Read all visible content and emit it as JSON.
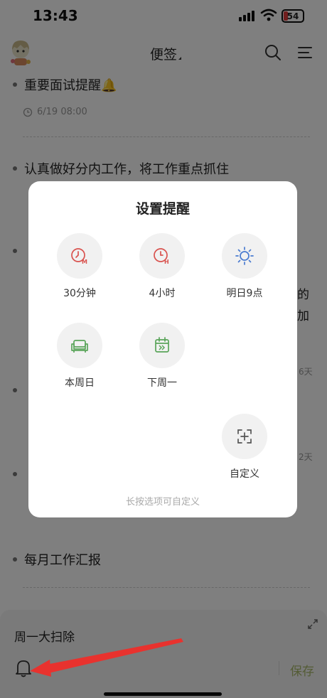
{
  "status_bar": {
    "time": "13:43",
    "battery": "54"
  },
  "header": {
    "title": "便签"
  },
  "notes": [
    {
      "title": "重要面试提醒🔔",
      "meta": "6/19 08:00"
    },
    {
      "title": "认真做好分内工作，将工作重点抓住"
    },
    {
      "title": "每月工作汇报"
    }
  ],
  "partial_text": {
    "row1_right": "的",
    "row2_right": "加",
    "days_a": "6天",
    "days_b": "2天"
  },
  "editor": {
    "text": "周一大扫除",
    "save_label": "保存"
  },
  "dialog": {
    "title": "设置提醒",
    "options": [
      {
        "label": "30分钟",
        "icon": "clock-m-icon"
      },
      {
        "label": "4小时",
        "icon": "clock-h-icon"
      },
      {
        "label": "明日9点",
        "icon": "sun-icon"
      },
      {
        "label": "本周日",
        "icon": "sofa-icon"
      },
      {
        "label": "下周一",
        "icon": "calendar-next-icon"
      },
      {
        "label": "自定义",
        "icon": "custom-plus-icon"
      }
    ],
    "hint": "长按选项可自定义"
  },
  "colors": {
    "red": "#d9534f",
    "blue": "#4a7bd0",
    "green": "#5aa55a",
    "save": "#a8b86a",
    "arrow": "#e8322e"
  }
}
